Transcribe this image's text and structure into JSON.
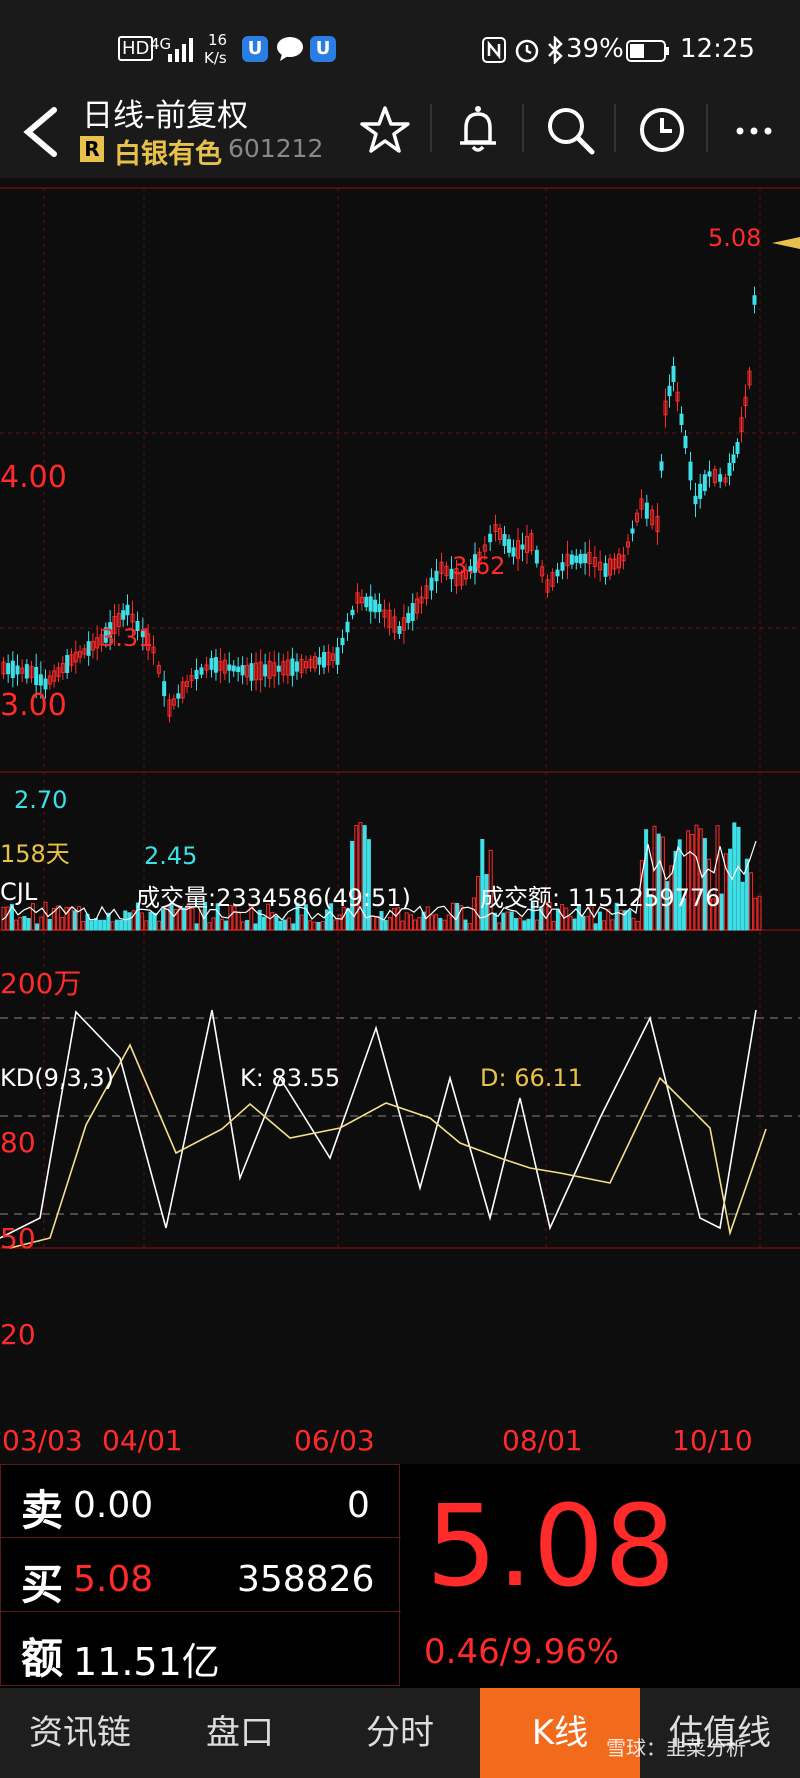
{
  "status_bar": {
    "hd": "HD",
    "net": "4G",
    "speed_top": "16",
    "speed_bottom": "K/s",
    "battery": "39%",
    "time": "12:25"
  },
  "header": {
    "title": "日线-前复权",
    "badge": "R",
    "stock_name": "白银有色",
    "stock_code": "601212"
  },
  "price_chart": {
    "label_high_right": "5.08",
    "label_400": "4.00",
    "label_300": "3.00",
    "label_362": "3.62",
    "label_331": "3.31",
    "label_270": "2.70",
    "label_245": "2.45",
    "days": "158天"
  },
  "volume": {
    "name": "CJL",
    "vol_text": "成交量:2334586(49:51)",
    "amount_text": "成交额: 1151259776",
    "scale": "200万"
  },
  "kd": {
    "name": "KD(9,3,3)",
    "k_text": "K: 83.55",
    "d_text": "D: 66.11",
    "lvl80": "80",
    "lvl50": "50",
    "lvl20": "20"
  },
  "dates": [
    "03/03",
    "04/01",
    "06/03",
    "08/01",
    "10/10"
  ],
  "quote": {
    "sell_label": "卖",
    "sell_price": "0.00",
    "sell_vol": "0",
    "buy_label": "买",
    "buy_price": "5.08",
    "buy_vol": "358826",
    "amt_label": "额",
    "amount": "11.51亿",
    "last_price": "5.08",
    "change": "0.46/9.96%"
  },
  "tabs": [
    "资讯链",
    "盘口",
    "分时",
    "K线",
    "估值线"
  ],
  "watermark": "雪球：韭菜分析",
  "colors": {
    "up": "#ff2a2a",
    "down": "#3ee0e8",
    "accent": "#f26a1b",
    "gold": "#e8c14a"
  }
}
